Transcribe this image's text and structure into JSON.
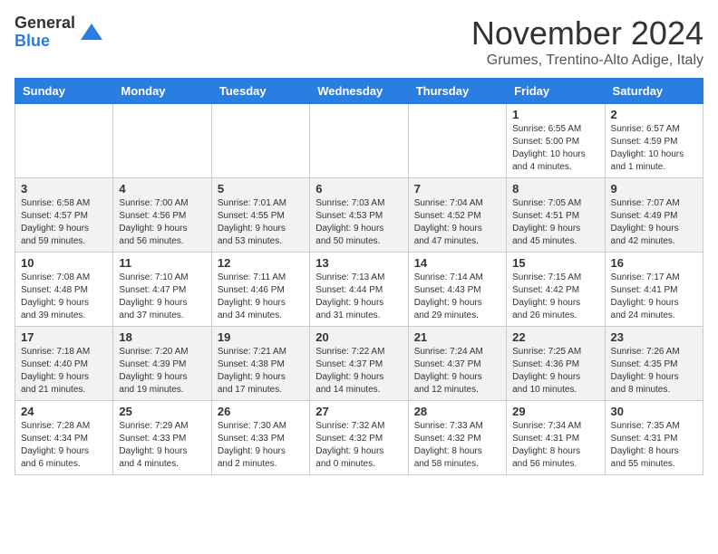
{
  "logo": {
    "general": "General",
    "blue": "Blue"
  },
  "title": "November 2024",
  "location": "Grumes, Trentino-Alto Adige, Italy",
  "weekdays": [
    "Sunday",
    "Monday",
    "Tuesday",
    "Wednesday",
    "Thursday",
    "Friday",
    "Saturday"
  ],
  "weeks": [
    [
      {
        "day": "",
        "info": ""
      },
      {
        "day": "",
        "info": ""
      },
      {
        "day": "",
        "info": ""
      },
      {
        "day": "",
        "info": ""
      },
      {
        "day": "",
        "info": ""
      },
      {
        "day": "1",
        "info": "Sunrise: 6:55 AM\nSunset: 5:00 PM\nDaylight: 10 hours\nand 4 minutes."
      },
      {
        "day": "2",
        "info": "Sunrise: 6:57 AM\nSunset: 4:59 PM\nDaylight: 10 hours\nand 1 minute."
      }
    ],
    [
      {
        "day": "3",
        "info": "Sunrise: 6:58 AM\nSunset: 4:57 PM\nDaylight: 9 hours\nand 59 minutes."
      },
      {
        "day": "4",
        "info": "Sunrise: 7:00 AM\nSunset: 4:56 PM\nDaylight: 9 hours\nand 56 minutes."
      },
      {
        "day": "5",
        "info": "Sunrise: 7:01 AM\nSunset: 4:55 PM\nDaylight: 9 hours\nand 53 minutes."
      },
      {
        "day": "6",
        "info": "Sunrise: 7:03 AM\nSunset: 4:53 PM\nDaylight: 9 hours\nand 50 minutes."
      },
      {
        "day": "7",
        "info": "Sunrise: 7:04 AM\nSunset: 4:52 PM\nDaylight: 9 hours\nand 47 minutes."
      },
      {
        "day": "8",
        "info": "Sunrise: 7:05 AM\nSunset: 4:51 PM\nDaylight: 9 hours\nand 45 minutes."
      },
      {
        "day": "9",
        "info": "Sunrise: 7:07 AM\nSunset: 4:49 PM\nDaylight: 9 hours\nand 42 minutes."
      }
    ],
    [
      {
        "day": "10",
        "info": "Sunrise: 7:08 AM\nSunset: 4:48 PM\nDaylight: 9 hours\nand 39 minutes."
      },
      {
        "day": "11",
        "info": "Sunrise: 7:10 AM\nSunset: 4:47 PM\nDaylight: 9 hours\nand 37 minutes."
      },
      {
        "day": "12",
        "info": "Sunrise: 7:11 AM\nSunset: 4:46 PM\nDaylight: 9 hours\nand 34 minutes."
      },
      {
        "day": "13",
        "info": "Sunrise: 7:13 AM\nSunset: 4:44 PM\nDaylight: 9 hours\nand 31 minutes."
      },
      {
        "day": "14",
        "info": "Sunrise: 7:14 AM\nSunset: 4:43 PM\nDaylight: 9 hours\nand 29 minutes."
      },
      {
        "day": "15",
        "info": "Sunrise: 7:15 AM\nSunset: 4:42 PM\nDaylight: 9 hours\nand 26 minutes."
      },
      {
        "day": "16",
        "info": "Sunrise: 7:17 AM\nSunset: 4:41 PM\nDaylight: 9 hours\nand 24 minutes."
      }
    ],
    [
      {
        "day": "17",
        "info": "Sunrise: 7:18 AM\nSunset: 4:40 PM\nDaylight: 9 hours\nand 21 minutes."
      },
      {
        "day": "18",
        "info": "Sunrise: 7:20 AM\nSunset: 4:39 PM\nDaylight: 9 hours\nand 19 minutes."
      },
      {
        "day": "19",
        "info": "Sunrise: 7:21 AM\nSunset: 4:38 PM\nDaylight: 9 hours\nand 17 minutes."
      },
      {
        "day": "20",
        "info": "Sunrise: 7:22 AM\nSunset: 4:37 PM\nDaylight: 9 hours\nand 14 minutes."
      },
      {
        "day": "21",
        "info": "Sunrise: 7:24 AM\nSunset: 4:37 PM\nDaylight: 9 hours\nand 12 minutes."
      },
      {
        "day": "22",
        "info": "Sunrise: 7:25 AM\nSunset: 4:36 PM\nDaylight: 9 hours\nand 10 minutes."
      },
      {
        "day": "23",
        "info": "Sunrise: 7:26 AM\nSunset: 4:35 PM\nDaylight: 9 hours\nand 8 minutes."
      }
    ],
    [
      {
        "day": "24",
        "info": "Sunrise: 7:28 AM\nSunset: 4:34 PM\nDaylight: 9 hours\nand 6 minutes."
      },
      {
        "day": "25",
        "info": "Sunrise: 7:29 AM\nSunset: 4:33 PM\nDaylight: 9 hours\nand 4 minutes."
      },
      {
        "day": "26",
        "info": "Sunrise: 7:30 AM\nSunset: 4:33 PM\nDaylight: 9 hours\nand 2 minutes."
      },
      {
        "day": "27",
        "info": "Sunrise: 7:32 AM\nSunset: 4:32 PM\nDaylight: 9 hours\nand 0 minutes."
      },
      {
        "day": "28",
        "info": "Sunrise: 7:33 AM\nSunset: 4:32 PM\nDaylight: 8 hours\nand 58 minutes."
      },
      {
        "day": "29",
        "info": "Sunrise: 7:34 AM\nSunset: 4:31 PM\nDaylight: 8 hours\nand 56 minutes."
      },
      {
        "day": "30",
        "info": "Sunrise: 7:35 AM\nSunset: 4:31 PM\nDaylight: 8 hours\nand 55 minutes."
      }
    ]
  ]
}
